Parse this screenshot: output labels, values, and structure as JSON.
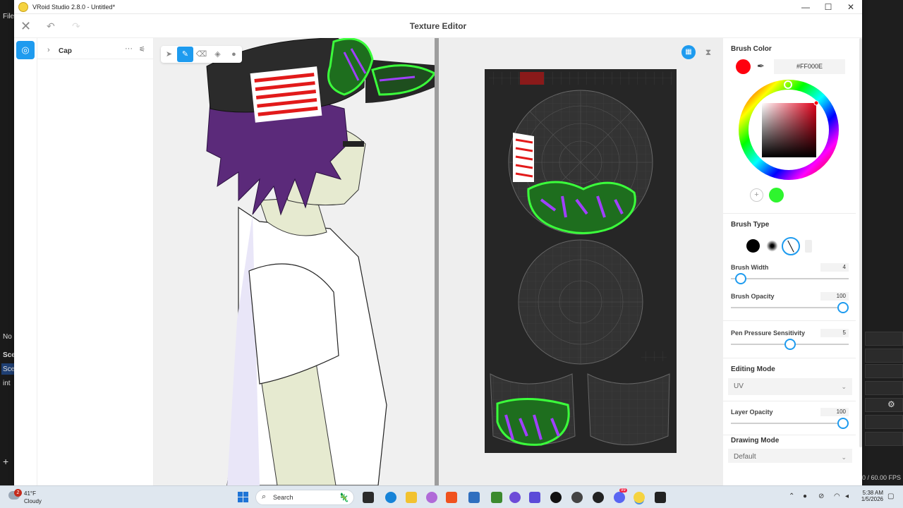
{
  "window": {
    "title": "VRoid Studio 2.8.0 - Untitled*"
  },
  "editor": {
    "title": "Texture Editor"
  },
  "layers": {
    "item_name": "Cap"
  },
  "brush": {
    "color_heading": "Brush Color",
    "hex": "#FF000E",
    "current_color": "#ff000e",
    "secondary_color": "#2ef52e",
    "type_heading": "Brush Type",
    "width_label": "Brush Width",
    "width_value": "4",
    "opacity_label": "Brush Opacity",
    "opacity_value": "100",
    "pressure_label": "Pen Pressure Sensitivity",
    "pressure_value": "5",
    "width_fraction": 0.04,
    "opacity_fraction": 1.0,
    "pressure_fraction": 0.5
  },
  "editing_mode": {
    "heading": "Editing Mode",
    "value": "UV"
  },
  "layer_opacity": {
    "label": "Layer Opacity",
    "value": "100",
    "fraction": 1.0
  },
  "drawing_mode": {
    "heading": "Drawing Mode",
    "value": "Default"
  },
  "background_app": {
    "menu_item": "File",
    "items": [
      "No",
      "Sce",
      "Sce",
      "int"
    ],
    "fps": "0 / 60.00 FPS"
  },
  "taskbar": {
    "temperature": "41°F",
    "condition": "Cloudy",
    "weather_badge": "2",
    "search_placeholder": "Search",
    "time": "5:38 AM",
    "date": "1/5/2026",
    "discord_badge": "99"
  },
  "colors": {
    "accent": "#1e9bef"
  }
}
